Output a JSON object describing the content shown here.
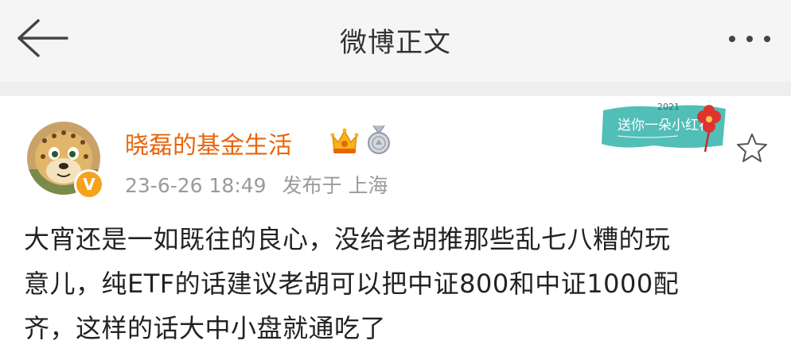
{
  "nav": {
    "title": "微博正文",
    "back_icon": "arrow-left-icon",
    "more_icon": "more-dots-icon"
  },
  "post": {
    "author": {
      "name": "晓磊的基金生活",
      "name_color": "#e8650a",
      "verified_badge": "V",
      "badges": [
        "crown-icon",
        "medal-icon"
      ]
    },
    "timestamp": "23-6-26 18:49",
    "location": "发布于 上海",
    "stamp": {
      "year": "2021",
      "text": "送你一朵小红花"
    },
    "favorite_icon": "star-outline-icon",
    "lines": [
      "大宵还是一如既往的良心，没给老胡推那些乱七八糟的玩",
      "意儿，纯ETF的话建议老胡可以把中证800和中证1000配",
      "齐，这样的话大中小盘就通吃了"
    ]
  }
}
